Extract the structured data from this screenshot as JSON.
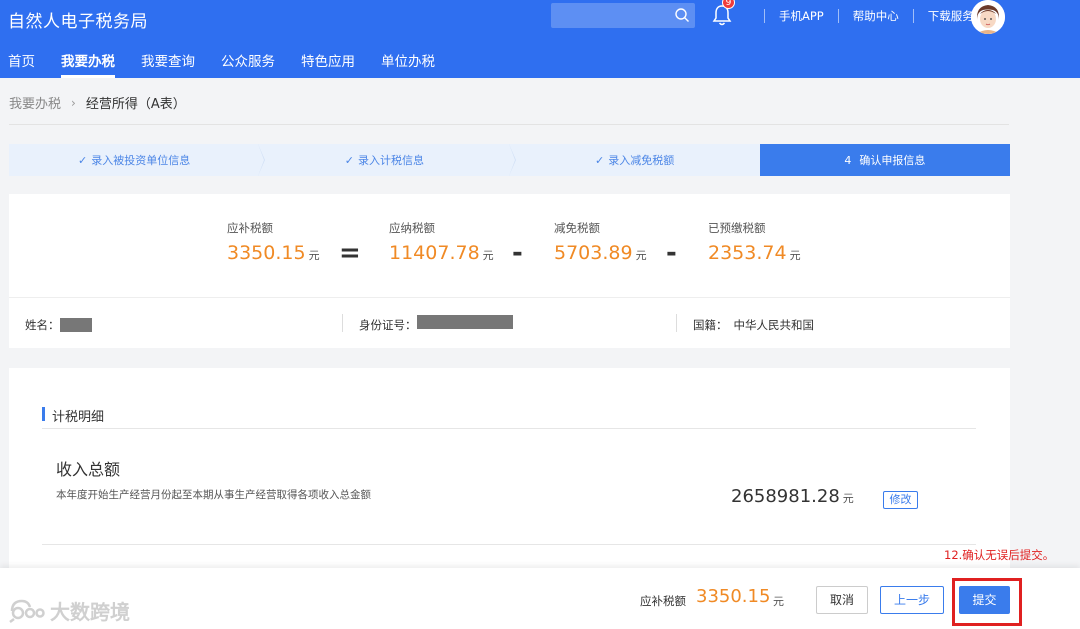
{
  "header": {
    "brand": "自然人电子税务局",
    "search_placeholder": "",
    "notification_count": "9",
    "links": [
      "手机APP",
      "帮助中心",
      "下载服务"
    ]
  },
  "nav": {
    "items": [
      "首页",
      "我要办税",
      "我要查询",
      "公众服务",
      "特色应用",
      "单位办税"
    ],
    "active_index": 1
  },
  "breadcrumb": {
    "parent": "我要办税",
    "current": "经营所得（A表）"
  },
  "steps": [
    {
      "label": "录入被投资单位信息",
      "done": true
    },
    {
      "label": "录入计税信息",
      "done": true
    },
    {
      "label": "录入减免税额",
      "done": true
    },
    {
      "number": "4",
      "label": "确认申报信息",
      "done": false,
      "active": true
    }
  ],
  "summary": {
    "unit": "元",
    "items": [
      {
        "label": "应补税额",
        "value": "3350.15"
      },
      {
        "label": "应纳税额",
        "value": "11407.78"
      },
      {
        "label": "减免税额",
        "value": "5703.89"
      },
      {
        "label": "已预缴税额",
        "value": "2353.74"
      }
    ],
    "operators": [
      "=",
      "-",
      "-"
    ]
  },
  "info": {
    "name_label": "姓名：",
    "id_label": "身份证号：",
    "nationality_label": "国籍：",
    "nationality_value": "中华人民共和国"
  },
  "detail": {
    "section_title": "计税明细",
    "income_title": "收入总额",
    "income_desc": "本年度开始生产经营月份起至本期从事生产经营取得各项收入总金额",
    "income_value": "2658981.28",
    "income_unit": "元",
    "edit_label": "修改"
  },
  "footer": {
    "watermark": "大数跨境",
    "tax_label": "应补税额",
    "tax_value": "3350.15",
    "tax_unit": "元",
    "cancel_label": "取消",
    "prev_label": "上一步",
    "submit_label": "提交",
    "annotation": "12.确认无误后提交。"
  },
  "colors": {
    "primary": "#2f6ff0",
    "accent_orange": "#f08a25",
    "annotation_red": "#e02020"
  }
}
